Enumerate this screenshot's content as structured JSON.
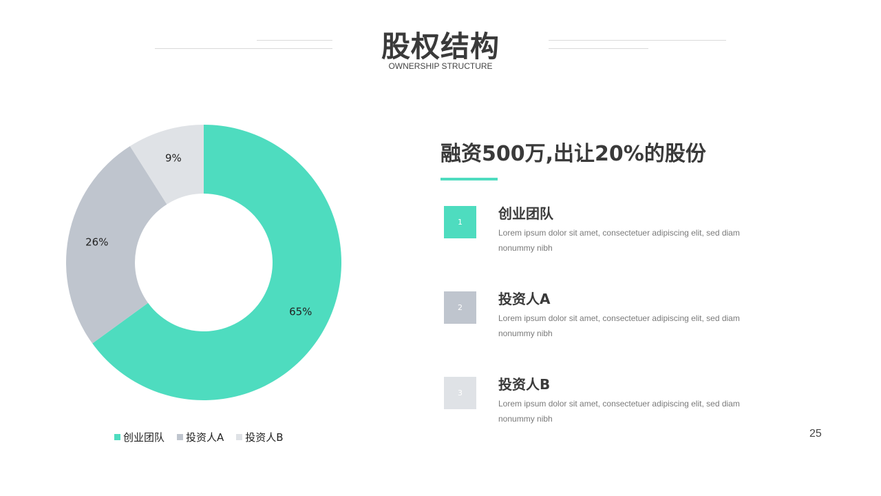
{
  "header": {
    "title": "股权结构",
    "subtitle": "OWNERSHIP STRUCTURE"
  },
  "colors": {
    "accent": "#4edcbf",
    "gray": "#bfc5ce",
    "light_gray": "#dfe2e6"
  },
  "chart_data": {
    "type": "pie",
    "donut": true,
    "categories": [
      "创业团队",
      "投资人A",
      "投资人B"
    ],
    "values": [
      65,
      26,
      9
    ],
    "labels": [
      "65%",
      "26%",
      "9%"
    ],
    "colors": [
      "#4edcbf",
      "#bfc5ce",
      "#dfe2e6"
    ],
    "legend_position": "bottom"
  },
  "legend": [
    {
      "label": "创业团队",
      "color": "#4edcbf"
    },
    {
      "label": "投资人A",
      "color": "#bfc5ce"
    },
    {
      "label": "投资人B",
      "color": "#dfe2e6"
    }
  ],
  "headline": "融资500万,出让20%的股份",
  "items": [
    {
      "number": "1",
      "title": "创业团队",
      "description": "Lorem ipsum dolor sit amet, consectetuer adipiscing elit, sed diam nonummy nibh",
      "color": "#4edcbf"
    },
    {
      "number": "2",
      "title": "投资人A",
      "description": "Lorem ipsum dolor sit amet, consectetuer adipiscing elit, sed diam nonummy nibh",
      "color": "#bfc5ce"
    },
    {
      "number": "3",
      "title": "投资人B",
      "description": "Lorem ipsum dolor sit amet, consectetuer adipiscing elit, sed diam nonummy nibh",
      "color": "#dfe2e6"
    }
  ],
  "page_number": "25"
}
